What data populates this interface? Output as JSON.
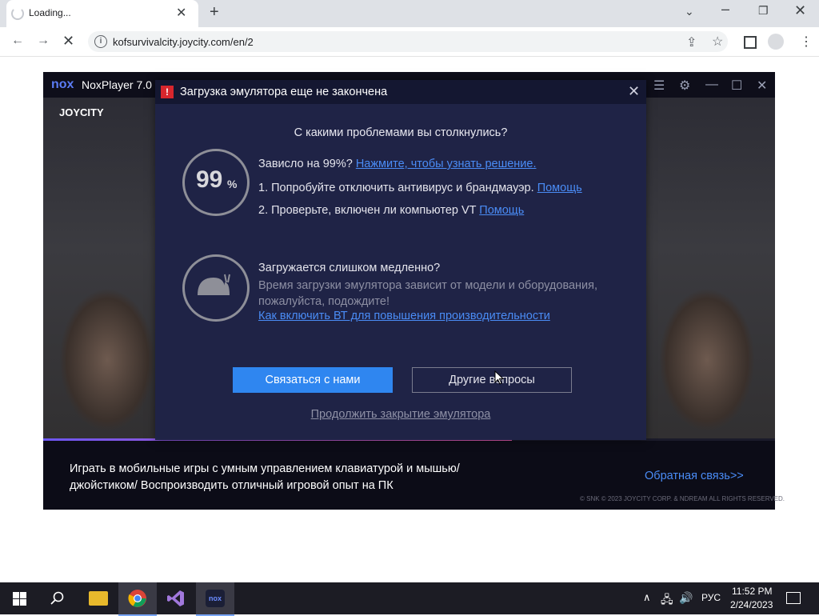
{
  "browser": {
    "tab_title": "Loading...",
    "url": "kofsurvivalcity.joycity.com/en/2"
  },
  "nox": {
    "logo": "nox",
    "app_name": "NoxPlayer 7.0",
    "brand": "JOYCITY",
    "promo_text": "Играть в мобильные игры с умным управлением клавиатурой и мышью/джойстиком/ Воспроизводить отличный игровой опыт на ПК",
    "feedback_link": "Обратная связь>>",
    "copyright": "© SNK © 2023 JOYCITY CORP. & NDREAM ALL RIGHTS RESERVED.",
    "progress_percent": 64
  },
  "dialog": {
    "title": "Загрузка эмулятора еще не закончена",
    "question": "С какими проблемами вы столкнулись?",
    "stuck_percent": "99",
    "percent_sign": "%",
    "stuck_label": "Зависло на 99%?",
    "stuck_link": "Нажмите, чтобы узнать решение.",
    "tip1": "1. Попробуйте отключить антивирус и брандмауэр.",
    "tip1_link": "Помощь",
    "tip2": "2. Проверьте, включен ли компьютер VT",
    "tip2_link": "Помощь",
    "slow_title": "Загружается слишком медленно?",
    "slow_desc1": "Время загрузки эмулятора зависит от модели и оборудования,",
    "slow_desc2": "пожалуйста, подождите!",
    "vt_link": "Как включить ВТ для повышения производительности",
    "contact_button": "Связаться с нами",
    "other_button": "Другие вопросы",
    "continue_link": "Продолжить закрытие эмулятора"
  },
  "taskbar": {
    "time": "11:52 PM",
    "date": "2/24/2023",
    "language": "РУС"
  }
}
